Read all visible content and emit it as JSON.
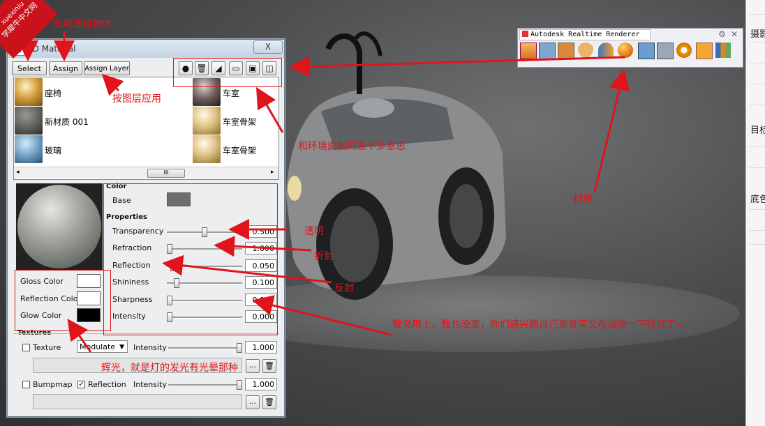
{
  "watermark": {
    "line1": "xuexiniu",
    "line2": "学犀牛中文网"
  },
  "material_window": {
    "title": "3D Material",
    "close_label": "X",
    "buttons": {
      "select": "Select",
      "assign": "Assign",
      "assign_layer": "Assign Layer"
    },
    "toolbar_icons": [
      "new-material-icon",
      "delete-icon",
      "brush-icon",
      "folder-open-icon",
      "save-icon",
      "library-book-icon"
    ],
    "materials": [
      {
        "name": "座椅",
        "icon": "gold-sphere"
      },
      {
        "name": "车室",
        "icon": "dark-metal-sphere"
      },
      {
        "name": "新材质 001",
        "icon": "gray-sphere"
      },
      {
        "name": "车室骨架",
        "icon": "gold-sphere"
      },
      {
        "name": "玻璃",
        "icon": "blue-mesh-sphere"
      },
      {
        "name": "车室骨架",
        "icon": "gold-sphere"
      }
    ],
    "scroll_thumb": "III",
    "color_section": "Color",
    "base_label": "Base",
    "base_color": "#6e6e6e",
    "properties_section": "Properties",
    "properties": [
      {
        "label": "Transparency",
        "value": "0.500",
        "level": 0.5
      },
      {
        "label": "Refraction",
        "value": "1.000",
        "level": 0.0
      },
      {
        "label": "Reflection",
        "value": "0.050",
        "level": 0.05
      },
      {
        "label": "Shininess",
        "value": "0.100",
        "level": 0.1
      },
      {
        "label": "Sharpness",
        "value": "0.000",
        "level": 0.0
      },
      {
        "label": "Intensity",
        "value": "0.000",
        "level": 0.0
      }
    ],
    "colors": [
      {
        "label": "Gloss Color",
        "color": "#ffffff"
      },
      {
        "label": "Reflection Color",
        "color": "#ffffff"
      },
      {
        "label": "Glow Color",
        "color": "#000000"
      }
    ],
    "textures_section": "Textures",
    "texture_row": {
      "label": "Texture",
      "checked": false,
      "mode": "Modulate",
      "intensity_label": "Intensity",
      "intensity": "1.000"
    },
    "bump_row": {
      "bump_label": "Bumpmap",
      "bump_checked": false,
      "reflection_label": "Reflection",
      "reflection_checked": true,
      "intensity_label": "Intensity",
      "intensity": "1.000"
    },
    "more_label": "...",
    "checkmark": "✓"
  },
  "renderer_toolbar": {
    "title": "Autodesk Realtime Renderer",
    "icons": [
      "render-window-icon",
      "fit-icon",
      "refresh-icon",
      "view-eye-icon",
      "environment-icon",
      "material-sphere-icon",
      "photo-icon",
      "camera-icon",
      "settings-gear-icon",
      "toolbox-icon",
      "bar-tools-icon"
    ]
  },
  "right_panel": {
    "labels": [
      "摄影",
      "目标",
      "底色"
    ]
  },
  "annotations": {
    "select_partial": "择",
    "apply_select": "应用选择物体",
    "apply_by_layer": "按图层应用",
    "env_panel_same": "和环境面板的差不多意思",
    "material": "材质",
    "transparency": "透明",
    "refraction": "折射",
    "reflection": "反射",
    "not_used": "我没用上，我也没查，你们感兴趣自己查查英文在试验一下就好了~",
    "glow_note": "辉光，就是灯的发光有光晕那种"
  },
  "colors": {
    "accent_red": "#e0141a"
  }
}
